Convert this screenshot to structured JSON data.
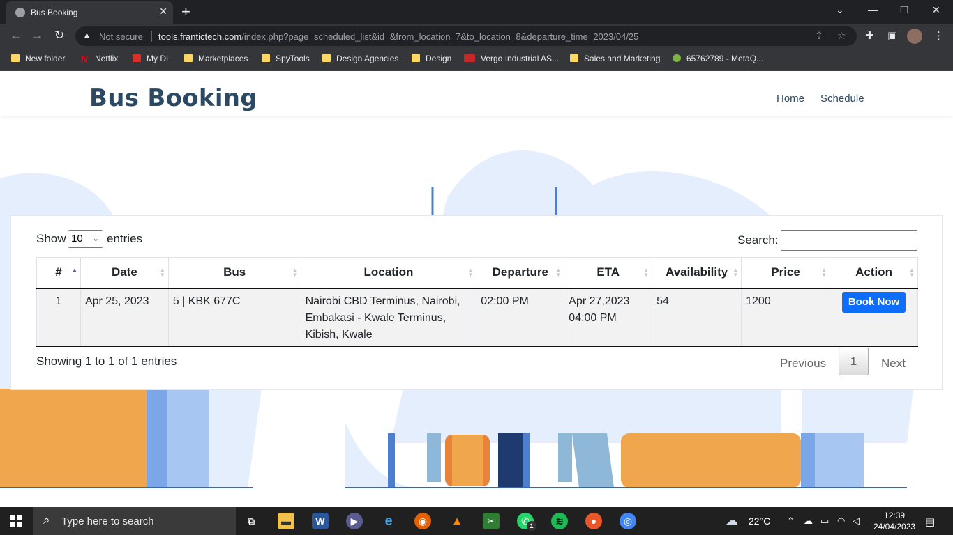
{
  "browser": {
    "tab_title": "Bus Booking",
    "new_tab": "+",
    "not_secure": "Not secure",
    "url_domain": "tools.frantictech.com",
    "url_path": "/index.php?page=scheduled_list&id=&from_location=7&to_location=8&departure_time=2023/04/25",
    "bookmarks": [
      "New folder",
      "Netflix",
      "My DL",
      "Marketplaces",
      "SpyTools",
      "Design Agencies",
      "Design",
      "Vergo Industrial AS...",
      "Sales and Marketing",
      "65762789 - MetaQ..."
    ]
  },
  "site": {
    "brand": "Bus Booking",
    "nav": [
      "Home",
      "Schedule"
    ]
  },
  "table_controls": {
    "show_label": "Show",
    "entries_value": "10",
    "entries_label": "entries",
    "search_label": "Search:",
    "search_value": ""
  },
  "table": {
    "columns": [
      "#",
      "Date",
      "Bus",
      "Location",
      "Departure",
      "ETA",
      "Availability",
      "Price",
      "Action"
    ],
    "sorted_column": "#",
    "rows": [
      {
        "num": "1",
        "date": "Apr 25, 2023",
        "bus": "5 | KBK 677C",
        "location": "Nairobi CBD Terminus, Nairobi, Embakasi - Kwale Terminus, Kibish, Kwale",
        "departure": "02:00 PM",
        "eta_date": "Apr 27,2023",
        "eta_time": "04:00 PM",
        "availability": "54",
        "price": "1200",
        "action": "Book Now"
      }
    ]
  },
  "footer": {
    "info": "Showing 1 to 1 of 1 entries",
    "previous": "Previous",
    "current_page": "1",
    "next": "Next"
  },
  "taskbar": {
    "search_placeholder": "Type here to search",
    "weather": "22°C",
    "time": "12:39",
    "date": "24/04/2023",
    "whatsapp_badge": "1"
  }
}
